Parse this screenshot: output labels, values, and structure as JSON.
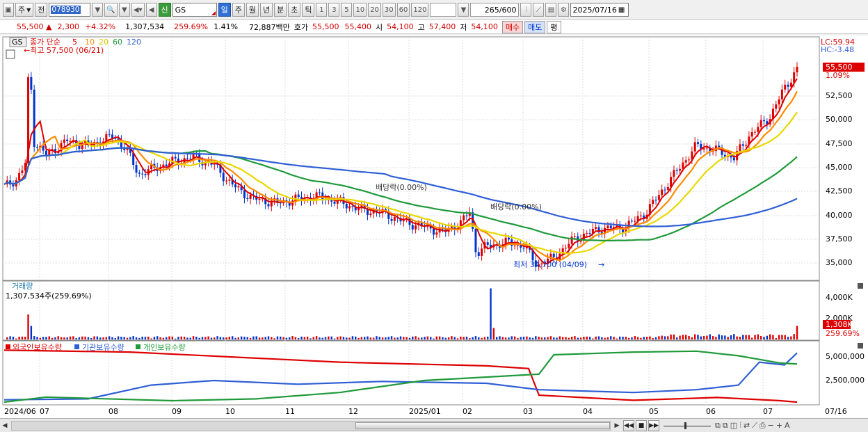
{
  "toolbar": {
    "period_label": "주",
    "prev_label": "전",
    "code": "078930",
    "name": "GS",
    "sin_label": "신",
    "tabs": [
      "일",
      "주",
      "월",
      "년",
      "분",
      "초",
      "틱"
    ],
    "numbers": [
      "1",
      "3",
      "5",
      "10",
      "20",
      "30",
      "60",
      "120"
    ],
    "count": "265",
    "count_total": "/600",
    "date": "2025/07/16"
  },
  "quote": {
    "price": "55,500",
    "change": "2,300",
    "change_pct": "+4.32%",
    "volume": "1,307,534",
    "volume_ratio": "259.69%",
    "turnover_pct": "1.41%",
    "amount": "72,887백만",
    "hoga_label": "호가",
    "ask": "55,500",
    "bid": "55,400",
    "open_label": "시",
    "open": "54,100",
    "high_label": "고",
    "high": "57,400",
    "low_label": "저",
    "low": "54,100",
    "buy_label": "매수",
    "sell_label": "매도",
    "flat_label": "평"
  },
  "legend": {
    "code_tag": "GS",
    "title": "종가 단순",
    "ma": [
      {
        "label": "5",
        "color": "#dd0000"
      },
      {
        "label": "10",
        "color": "#ff8c00"
      },
      {
        "label": "20",
        "color": "#e8d800"
      },
      {
        "label": "60",
        "color": "#1f9a3a"
      },
      {
        "label": "120",
        "color": "#2f5fd6"
      }
    ],
    "lc": "LC:59.94",
    "hc": "HC:-3.48"
  },
  "annotations": {
    "high": "←최고 57,500 (06/21)",
    "low": "최저 34,700 (04/09)",
    "dividend1": "배당락(0.00%)",
    "dividend2": "배당락(0.00%)"
  },
  "price_axis": {
    "ticks": [
      "52,500",
      "50,000",
      "47,500",
      "45,000",
      "42,500",
      "40,000",
      "37,500",
      "35,000"
    ],
    "current": "55,500",
    "current_pct": "1.09%"
  },
  "volume_panel": {
    "title": "거래량",
    "value": "1,307,534주(259.69%)",
    "ticks": [
      "4,000K",
      "2,000K"
    ],
    "current": "1,308K",
    "current_pct": "259.69%"
  },
  "holding_panel": {
    "legend": [
      {
        "label": "외국인보유수량",
        "color": "#dd0000"
      },
      {
        "label": "기관보유수량",
        "color": "#2f5fd6"
      },
      {
        "label": "개인보유수량",
        "color": "#1f9a3a"
      }
    ],
    "ticks": [
      "5,000,000",
      "2,500,000"
    ]
  },
  "x_axis": {
    "labels": [
      "2024/06",
      "07",
      "08",
      "09",
      "10",
      "11",
      "12",
      "2025/01",
      "02",
      "03",
      "04",
      "05",
      "06",
      "07"
    ],
    "right_label": "07/16"
  },
  "colors": {
    "up": "#dd0000",
    "down": "#0033cc",
    "grid": "#cccccc"
  }
}
